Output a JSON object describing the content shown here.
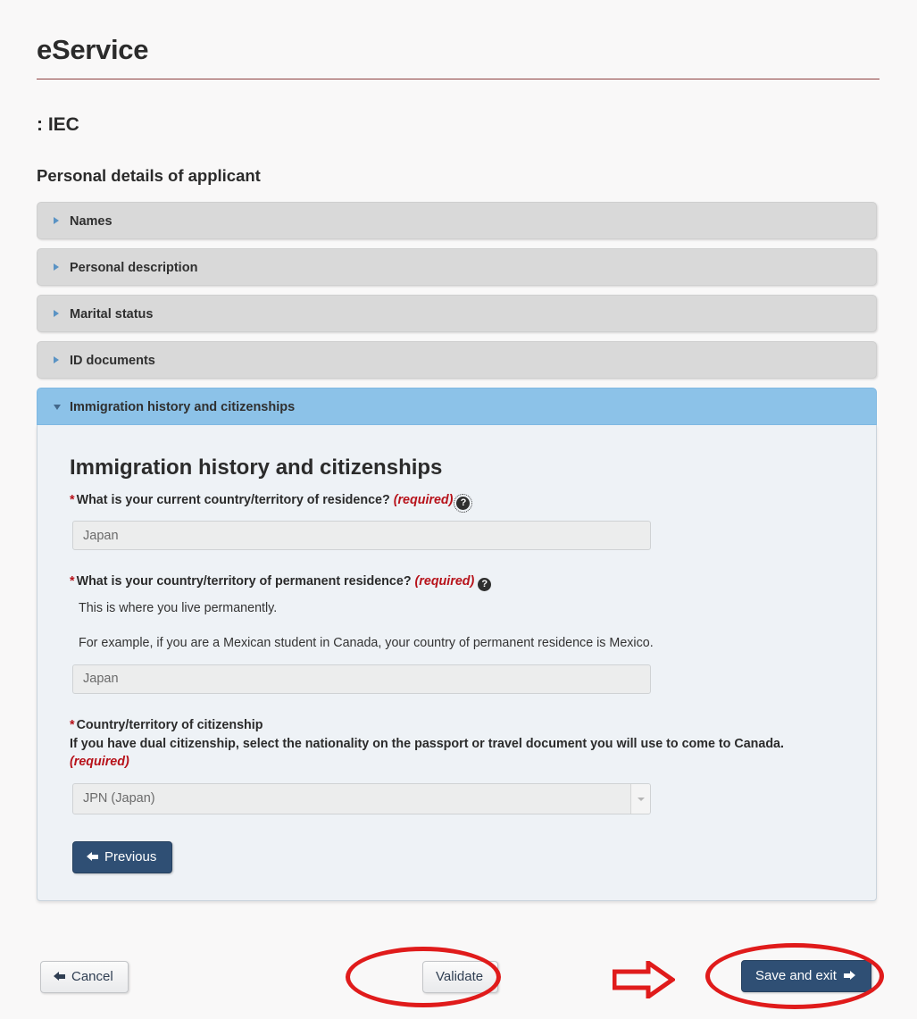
{
  "header": {
    "app_title": "eService",
    "page_subtitle": ": IEC",
    "section_title": "Personal details of applicant",
    "rule_color": "#8d3e3e"
  },
  "accordion": {
    "items": [
      {
        "label": "Names",
        "state": "collapsed",
        "icon": "triangle-right-icon"
      },
      {
        "label": "Personal description",
        "state": "collapsed",
        "icon": "triangle-right-icon"
      },
      {
        "label": "Marital status",
        "state": "collapsed",
        "icon": "triangle-right-icon"
      },
      {
        "label": "ID documents",
        "state": "collapsed",
        "icon": "triangle-right-icon"
      },
      {
        "label": "Immigration history and citizenships",
        "state": "expanded",
        "icon": "triangle-down-icon"
      }
    ],
    "open_header_color": "#8cc2e8",
    "collapsed_header_color": "#d9d9d9"
  },
  "panel": {
    "heading": "Immigration history and citizenships",
    "fields": [
      {
        "asterisk": "*",
        "label": "What is your current country/territory of residence?",
        "required_text": "(required)",
        "help_icon": "question-mark-circle-icon",
        "help_icon_focused": true,
        "value": "Japan",
        "control": "text"
      },
      {
        "asterisk": "*",
        "label": "What is your country/territory of permanent residence?",
        "required_text": "(required)",
        "help_icon": "question-mark-circle-icon",
        "help_icon_focused": false,
        "hint1": "This is where you live permanently.",
        "hint2": "For example, if you are a Mexican student in Canada, your country of permanent residence is Mexico.",
        "value": "Japan",
        "control": "text"
      },
      {
        "asterisk": "*",
        "label_line1": "Country/territory of citizenship",
        "label_line2": "If you have dual citizenship, select the nationality on the passport or travel document you will use to come to Canada.",
        "required_text": "(required)",
        "value": "JPN (Japan)",
        "control": "select",
        "select_icon": "chevron-down-icon"
      }
    ],
    "previous_button": {
      "label": "Previous",
      "icon": "arrow-left-icon"
    },
    "background_color": "#eef2f6"
  },
  "bottom_bar": {
    "cancel": {
      "label": "Cancel",
      "icon": "arrow-left-icon"
    },
    "validate": {
      "label": "Validate"
    },
    "save_and_exit": {
      "label": "Save and exit",
      "icon": "arrow-right-icon"
    }
  },
  "annotations": {
    "color": "#e01b1b",
    "shapes": [
      {
        "type": "ellipse",
        "target": "validate-button"
      },
      {
        "type": "ellipse",
        "target": "save-and-exit-button"
      },
      {
        "type": "arrow-right",
        "target": "save-and-exit-button"
      }
    ]
  }
}
